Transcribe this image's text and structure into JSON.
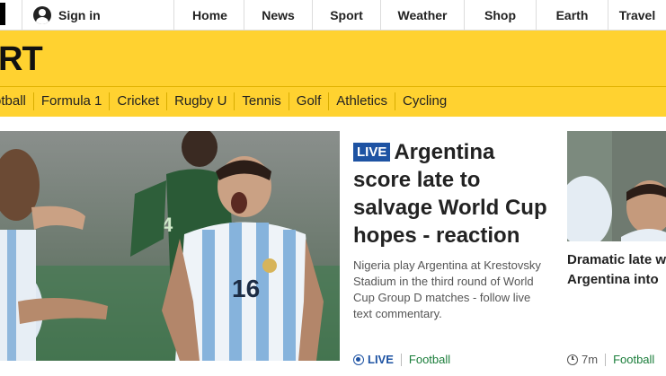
{
  "topbar": {
    "signin_label": "Sign in",
    "nav": [
      {
        "label": "Home",
        "width": 0
      },
      {
        "label": "News"
      },
      {
        "label": "Sport"
      },
      {
        "label": "Weather"
      },
      {
        "label": "Shop"
      },
      {
        "label": "Earth"
      },
      {
        "label": "Travel"
      }
    ]
  },
  "sport": {
    "title": "RT",
    "subnav": [
      "otball",
      "Formula 1",
      "Cricket",
      "Rugby U",
      "Tennis",
      "Golf",
      "Athletics",
      "Cycling"
    ]
  },
  "main_story": {
    "live_badge": "LIVE",
    "headline": "Argentina score late to salvage World Cup hopes - reaction",
    "summary": "Nigeria play Argentina at Krestovsky Stadium in the third round of World Cup Group D matches - follow live text commentary.",
    "meta_live": "LIVE",
    "meta_section": "Football"
  },
  "side_story": {
    "title_line1": "Dramatic late w",
    "title_line2": "Argentina into",
    "time": "7m",
    "section": "Football"
  },
  "colors": {
    "sport_yellow": "#ffd230",
    "live_blue": "#1e53a3",
    "section_green": "#1a7d3a"
  },
  "icons": [
    "logo-mark",
    "user-icon",
    "live-icon",
    "clock-icon"
  ]
}
